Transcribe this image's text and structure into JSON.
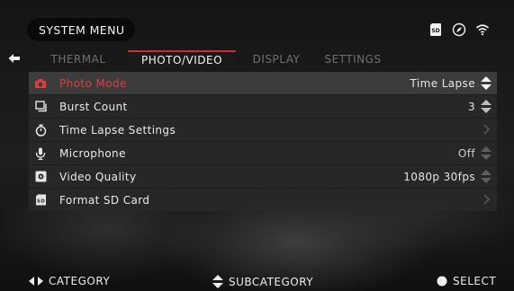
{
  "header": {
    "title": "SYSTEM MENU",
    "status_icons": [
      "sd-card-icon",
      "compass-icon",
      "wifi-icon"
    ]
  },
  "tabs": [
    {
      "label": "THERMAL",
      "active": false
    },
    {
      "label": "PHOTO/VIDEO",
      "active": true
    },
    {
      "label": "DISPLAY",
      "active": false
    },
    {
      "label": "SETTINGS",
      "active": false
    }
  ],
  "menu": {
    "items": [
      {
        "label": "Photo Mode",
        "value": "Time Lapse",
        "icon": "camera-icon",
        "control": "stepper",
        "selected": true
      },
      {
        "label": "Burst Count",
        "value": "3",
        "icon": "burst-icon",
        "control": "stepper",
        "selected": false
      },
      {
        "label": "Time Lapse Settings",
        "value": "",
        "icon": "stopwatch-icon",
        "control": "chevron",
        "selected": false
      },
      {
        "label": "Microphone",
        "value": "Off",
        "icon": "microphone-icon",
        "control": "stepper",
        "selected": false
      },
      {
        "label": "Video Quality",
        "value": "1080p 30fps",
        "icon": "video-quality-icon",
        "control": "stepper",
        "selected": false
      },
      {
        "label": "Format SD Card",
        "value": "",
        "icon": "sd-card-icon",
        "control": "chevron",
        "selected": false
      }
    ]
  },
  "footer": {
    "category": "CATEGORY",
    "subcategory": "SUBCATEGORY",
    "select": "SELECT"
  },
  "colors": {
    "accent": "#d22b2b",
    "selected_text": "#e23b3b",
    "row_bg": "#282828",
    "selected_row_bg": "#3c3c3c"
  }
}
